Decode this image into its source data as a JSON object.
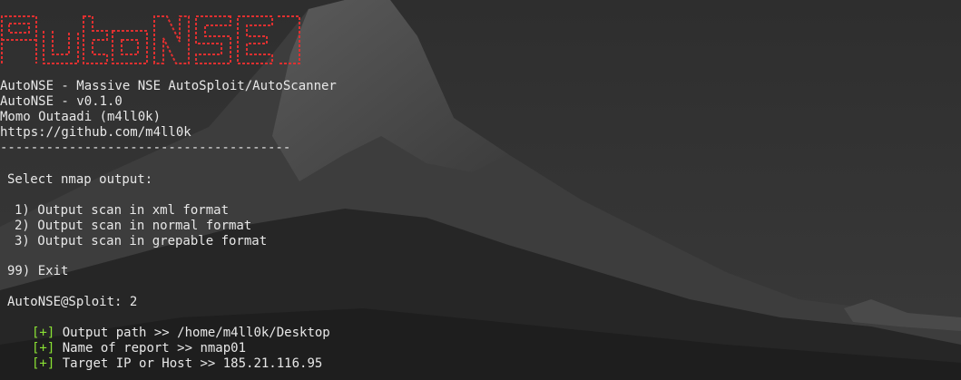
{
  "banner": {
    "text": "AutoNSE",
    "color": "#e03030"
  },
  "header": {
    "title": "AutoNSE - Massive NSE AutoSploit/AutoScanner",
    "version": "AutoNSE - v0.1.0",
    "author": "Momo Outaadi (m4ll0k)",
    "url": "https://github.com/m4ll0k",
    "separator": "--------------------------------------"
  },
  "menu": {
    "prompt": "Select nmap output:",
    "options": [
      "1) Output scan in xml format",
      "2) Output scan in normal format",
      "3) Output scan in grepable format"
    ],
    "exit": "99) Exit"
  },
  "input": {
    "prompt": "AutoNSE@Sploit: 2"
  },
  "results": [
    {
      "marker": "[+]",
      "text": " Output path >> /home/m4ll0k/Desktop"
    },
    {
      "marker": "[+]",
      "text": " Name of report >> nmap01"
    },
    {
      "marker": "[+]",
      "text": " Target IP or Host >> 185.21.116.95"
    }
  ],
  "colors": {
    "text": "#e8e8e8",
    "success_marker": "#8ae234",
    "banner": "#e03030"
  }
}
